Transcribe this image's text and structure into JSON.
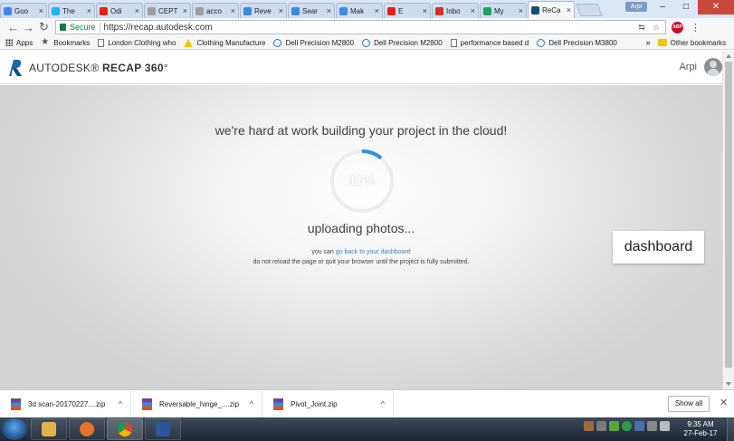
{
  "browser": {
    "tabs": [
      {
        "label": "Goo",
        "icon": "google-icon",
        "color": "#4285f4"
      },
      {
        "label": "The",
        "icon": "vimeo-icon",
        "color": "#1ab7ea"
      },
      {
        "label": "Odi",
        "icon": "youtube-icon",
        "color": "#e62117"
      },
      {
        "label": "CEPT",
        "icon": "page-icon",
        "color": "#9e9e9e"
      },
      {
        "label": "acco",
        "icon": "page-icon",
        "color": "#9e9e9e"
      },
      {
        "label": "Reve",
        "icon": "recap-icon",
        "color": "#3d8ad6"
      },
      {
        "label": "Sear",
        "icon": "recap-icon",
        "color": "#3d8ad6"
      },
      {
        "label": "Mak",
        "icon": "asterisk-icon",
        "color": "#3a8cdf"
      },
      {
        "label": "E",
        "icon": "youtube-icon",
        "color": "#e62117"
      },
      {
        "label": "Inbo",
        "icon": "gmail-icon",
        "color": "#d93025"
      },
      {
        "label": "My",
        "icon": "drive-icon",
        "color": "#1fa463"
      },
      {
        "label": "ReCa",
        "icon": "autodesk-icon",
        "color": "#0e4f7d",
        "active": true
      }
    ],
    "profile_chip": "Arpi",
    "address": {
      "secure_label": "Secure",
      "url": "https://recap.autodesk.com"
    },
    "bookmarks": [
      {
        "label": "Apps",
        "icon": "apps-icon"
      },
      {
        "label": "Bookmarks",
        "icon": "star-icon"
      },
      {
        "label": "London Clothing who",
        "icon": "page-icon"
      },
      {
        "label": "Clothing Manufacture",
        "icon": "warning-icon"
      },
      {
        "label": "Dell Precision M2800",
        "icon": "dell-icon"
      },
      {
        "label": "Dell Precision M2800",
        "icon": "dell-icon"
      },
      {
        "label": "performance based d",
        "icon": "page-icon"
      },
      {
        "label": "Dell Precision M3800",
        "icon": "dell-icon"
      }
    ],
    "bookmarks_overflow": "»",
    "other_bookmarks": "Other bookmarks"
  },
  "app": {
    "brand_prefix": "AUTODESK",
    "brand_name": "RECAP 360",
    "user_name": "Arpi"
  },
  "main": {
    "headline": "we're hard at work building your project in the cloud!",
    "progress_percent": 11,
    "progress_label": "11%",
    "status": "uploading photos...",
    "hint_prefix": "you can ",
    "hint_link": "go back to your dashboard",
    "warning": "do not reload the page or quit your browser until the project is fully submitted.",
    "dashboard_button": "dashboard",
    "colors": {
      "progress": "#2a8fe0",
      "track": "#ececec"
    }
  },
  "downloads": {
    "items": [
      {
        "name": "3d scan-20170227....zip"
      },
      {
        "name": "Reversable_hinge_....zip"
      },
      {
        "name": "Pivot_Joint.zip"
      }
    ],
    "show_all": "Show all"
  },
  "taskbar": {
    "time": "9:35 AM",
    "date": "27-Feb-17"
  }
}
